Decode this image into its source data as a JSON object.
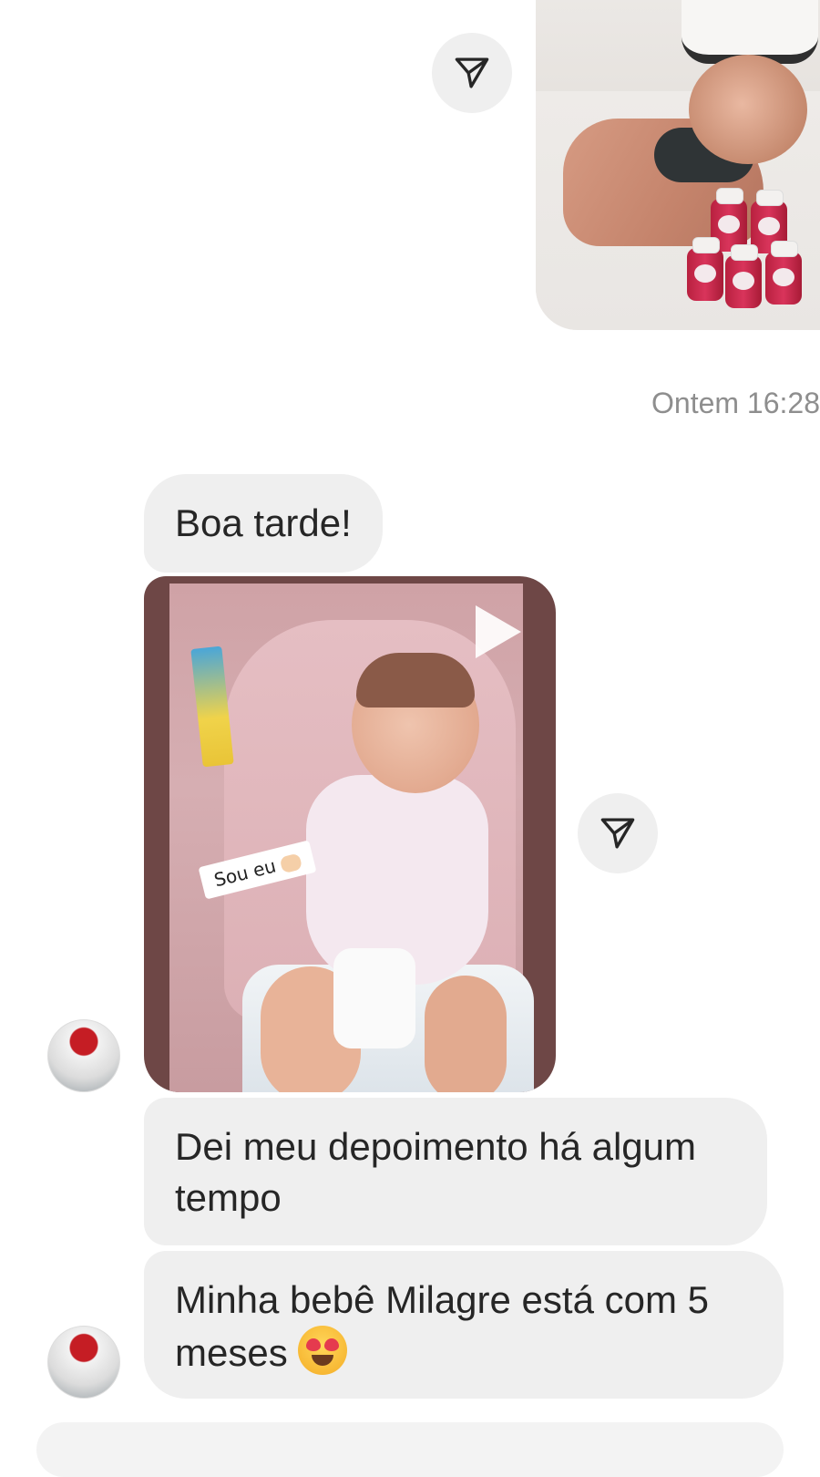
{
  "chat": {
    "timestamp": "Ontem 16:28",
    "messages": [
      {
        "text": "Boa tarde!"
      },
      {
        "text": "Dei meu depoimento há algum tempo"
      },
      {
        "text": "Minha bebê Milagre está com 5 meses"
      }
    ],
    "video_sticker_text": "Sou eu"
  },
  "icons": {
    "share": "paper-plane-icon",
    "play": "play-icon",
    "emoji": "heart-eyes-emoji"
  },
  "colors": {
    "bubble_bg": "#efefef",
    "timestamp": "#8e8e8e",
    "share_bg": "#efefef"
  }
}
